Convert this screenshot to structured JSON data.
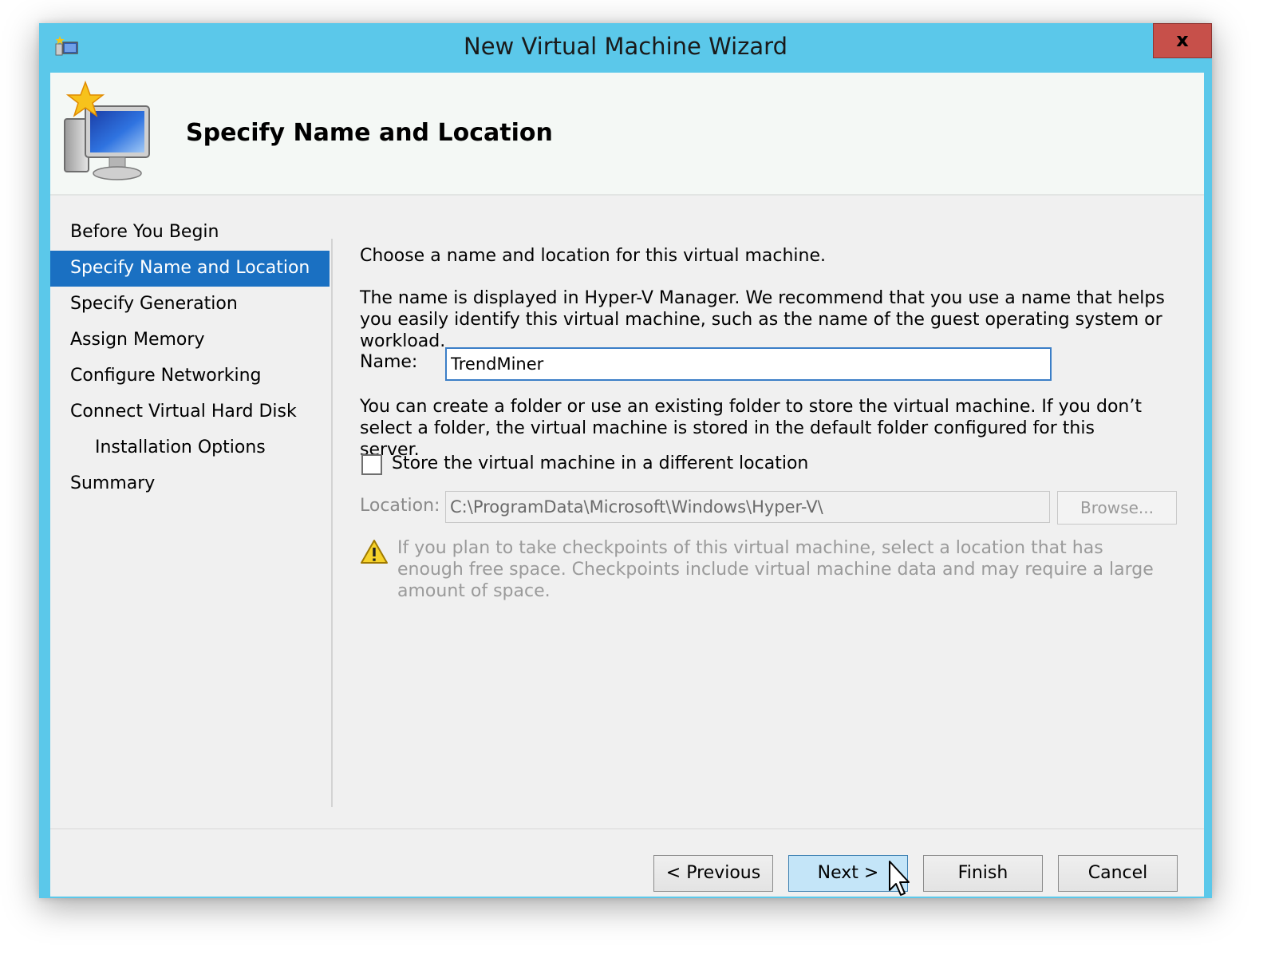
{
  "window": {
    "title": "New Virtual Machine Wizard",
    "close_label": "x"
  },
  "header": {
    "title": "Specify Name and Location"
  },
  "nav": {
    "items": [
      {
        "label": "Before You Begin"
      },
      {
        "label": "Specify Name and Location",
        "active": true
      },
      {
        "label": "Specify Generation"
      },
      {
        "label": "Assign Memory"
      },
      {
        "label": "Configure Networking"
      },
      {
        "label": "Connect Virtual Hard Disk"
      },
      {
        "label": "Installation Options",
        "sub": true
      },
      {
        "label": "Summary"
      }
    ]
  },
  "content": {
    "intro": "Choose a name and location for this virtual machine.",
    "name_help": "The name is displayed in Hyper-V Manager. We recommend that you use a name that helps you easily identify this virtual machine, such as the name of the guest operating system or workload.",
    "name_label": "Name:",
    "name_value": "TrendMiner",
    "folder_help": "You can create a folder or use an existing folder to store the virtual machine. If you don’t select a folder, the virtual machine is stored in the default folder configured for this server.",
    "store_checkbox_label": "Store the virtual machine in a different location",
    "store_checkbox_checked": false,
    "location_label": "Location:",
    "location_value": "C:\\ProgramData\\Microsoft\\Windows\\Hyper-V\\",
    "browse_label": "Browse...",
    "warning_text": "If you plan to take checkpoints of this virtual machine, select a location that has enough free space. Checkpoints include virtual machine data and may require a large amount of space."
  },
  "footer": {
    "previous_label": "< Previous",
    "next_label": "Next >",
    "finish_label": "Finish",
    "cancel_label": "Cancel"
  },
  "colors": {
    "frame": "#5bc8ea",
    "selection": "#1a70c2",
    "close": "#c7504a",
    "primary_button": "#c4e5f8"
  }
}
